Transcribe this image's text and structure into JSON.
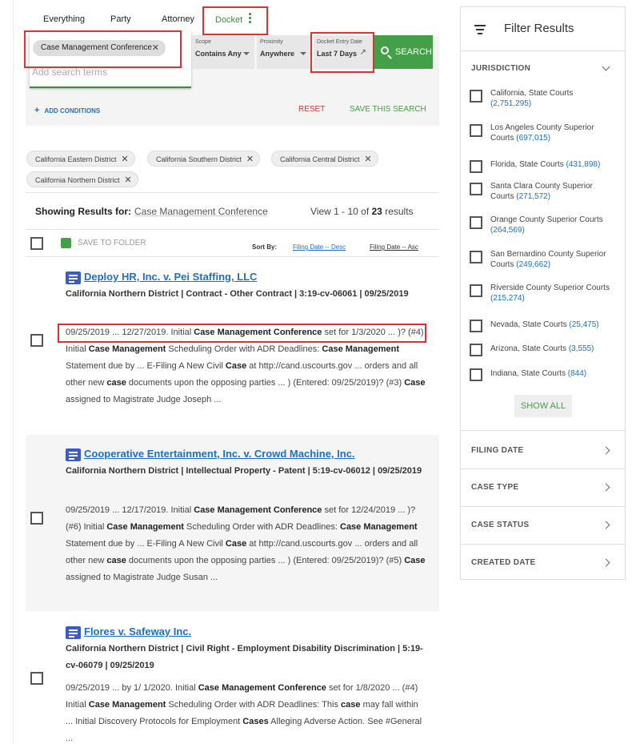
{
  "tabs": {
    "everything": "Everything",
    "party": "Party",
    "attorney": "Attorney",
    "docket": "Docket"
  },
  "search": {
    "term_chip": "Case Management Conference",
    "placeholder": "Add search terms",
    "scope_caption": "Scope",
    "scope_value": "Contains Any",
    "proximity_caption": "Proximity",
    "proximity_value": "Anywhere",
    "date_caption": "Docket Entry Date",
    "date_value": "Last 7 Days",
    "search_button": "SEARCH",
    "add_conditions": "ADD CONDITIONS",
    "reset": "RESET",
    "save_search": "SAVE THIS SEARCH"
  },
  "filter_chips": [
    "California Eastern District",
    "California Southern District",
    "California Central District",
    "California Northern District"
  ],
  "results_summary": {
    "showing_label": "Showing Results for:",
    "query": "Case Management Conference",
    "view_prefix": "View 1 - 10 of",
    "total": "23",
    "view_suffix": "results"
  },
  "toolbar": {
    "save_to_folder": "SAVE TO FOLDER",
    "sort_by": "Sort By:",
    "sort_desc": "Filing Date -- Desc",
    "sort_asc": "Filing Date -- Asc"
  },
  "results": [
    {
      "title": "Deploy HR, Inc. v. Pei Staffing, LLC",
      "meta": "California Northern District | Contract - Other Contract | 3:19-cv-06061 | 09/25/2019",
      "snippet_html": "09/25/2019 ... 12/27/2019. Initial <b>Case Management Conference</b> set for 1/3/2020 ... )? (#4) Initial <b>Case Management</b> Scheduling Order with ADR Deadlines: <b>Case Management</b> Statement due by ... E-Filing A New Civil <b>Case</b> at http://cand.uscourts.gov ... orders and all other new <b>case</b> documents upon the opposing parties ... ) (Entered: 09/25/2019)? (#3) <b>Case</b> assigned to Magistrate Judge Joseph ..."
    },
    {
      "title": "Cooperative Entertainment, Inc. v. Crowd Machine, Inc.",
      "meta": "California Northern District | Intellectual Property - Patent | 5:19-cv-06012 | 09/25/2019",
      "snippet_html": "09/25/2019 ... 12/17/2019. Initial <b>Case Management Conference</b> set for 12/24/2019 ... )? (#6) Initial <b>Case Management</b> Scheduling Order with ADR Deadlines: <b>Case Management</b> Statement due by ... E-Filing A New Civil <b>Case</b> at http://cand.uscourts.gov ... orders and all other new <b>case</b> documents upon the opposing parties ... ) (Entered: 09/25/2019)? (#5) <b>Case</b> assigned to Magistrate Judge Susan ..."
    },
    {
      "title": "Flores v. Safeway Inc.",
      "meta": "California Northern District | Civil Right - Employment Disability Discrimination | 5:19-cv-06079 | 09/25/2019",
      "snippet_html": "09/25/2019 ... by 1/ 1/2020. Initial <b>Case Management Conference</b> set for 1/8/2020 ... (#4) Initial <b>Case Management</b> Scheduling Order with ADR Deadlines: This <b>case</b> may fall within ... Initial Discovery Protocols for Employment <b>Cases</b> Alleging Adverse Action. See #General ..."
    }
  ],
  "sidebar": {
    "title": "Filter Results",
    "jurisdiction": "JURISDICTION",
    "items": [
      {
        "label": "California, State Courts",
        "count": "(2,751,295)"
      },
      {
        "label": "Los Angeles County Superior Courts",
        "count": "(697,015)"
      },
      {
        "label": "Florida, State Courts",
        "count": "(431,898)"
      },
      {
        "label": "Santa Clara County Superior Courts",
        "count": "(271,572)"
      },
      {
        "label": "Orange County Superior Courts",
        "count": "(264,569)"
      },
      {
        "label": "San Bernardino County Superior Courts",
        "count": "(249,662)"
      },
      {
        "label": "Riverside County Superior Courts",
        "count": "(215,274)"
      },
      {
        "label": "Nevada, State Courts",
        "count": "(25,475)"
      },
      {
        "label": "Arizona, State Courts",
        "count": "(3,555)"
      },
      {
        "label": "Indiana, State Courts",
        "count": "(844)"
      }
    ],
    "show_all": "SHOW ALL",
    "sections": [
      "FILING DATE",
      "CASE TYPE",
      "CASE STATUS",
      "CREATED DATE"
    ]
  }
}
